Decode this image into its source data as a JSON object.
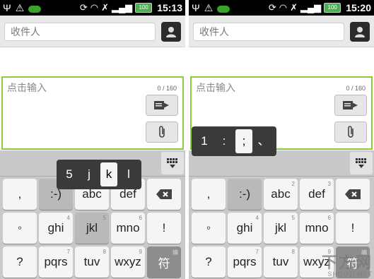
{
  "status_bar": {
    "left_icons": [
      "usb-icon",
      "warning-icon",
      "pea-icon"
    ],
    "right_icons": [
      "sync-icon",
      "wifi-icon",
      "vibrate-icon",
      "signal-icon",
      "battery-icon"
    ],
    "battery": "100",
    "time_left": "15:13",
    "time_right": "15:20"
  },
  "recipient": {
    "placeholder": "收件人"
  },
  "compose": {
    "placeholder": "点击输入",
    "counter": "0 / 160"
  },
  "keyboard": {
    "row1": [
      ",",
      ":-)",
      "abc",
      "def"
    ],
    "row2": [
      "◦",
      "ghi",
      "jkl",
      "mno",
      "!"
    ],
    "row3": [
      "?",
      "pqrs",
      "tuv",
      "wxyz",
      "符"
    ],
    "sub_labels": {
      "abc": "2",
      "def": "3",
      "ghi": "4",
      "jkl": "5",
      "mno": "6",
      "pqrs": "7",
      "tuv": "8",
      "wxyz": "9",
      "sym": "编"
    }
  },
  "popup_left": [
    "5",
    "j",
    "k",
    "l"
  ],
  "popup_right": [
    "1",
    ":",
    ";",
    "、"
  ],
  "watermark": {
    "cn": "下方网",
    "en": "SHOUJI.NET"
  },
  "colors": {
    "accent_green": "#8bcc3a",
    "statusbar": "#000000"
  }
}
